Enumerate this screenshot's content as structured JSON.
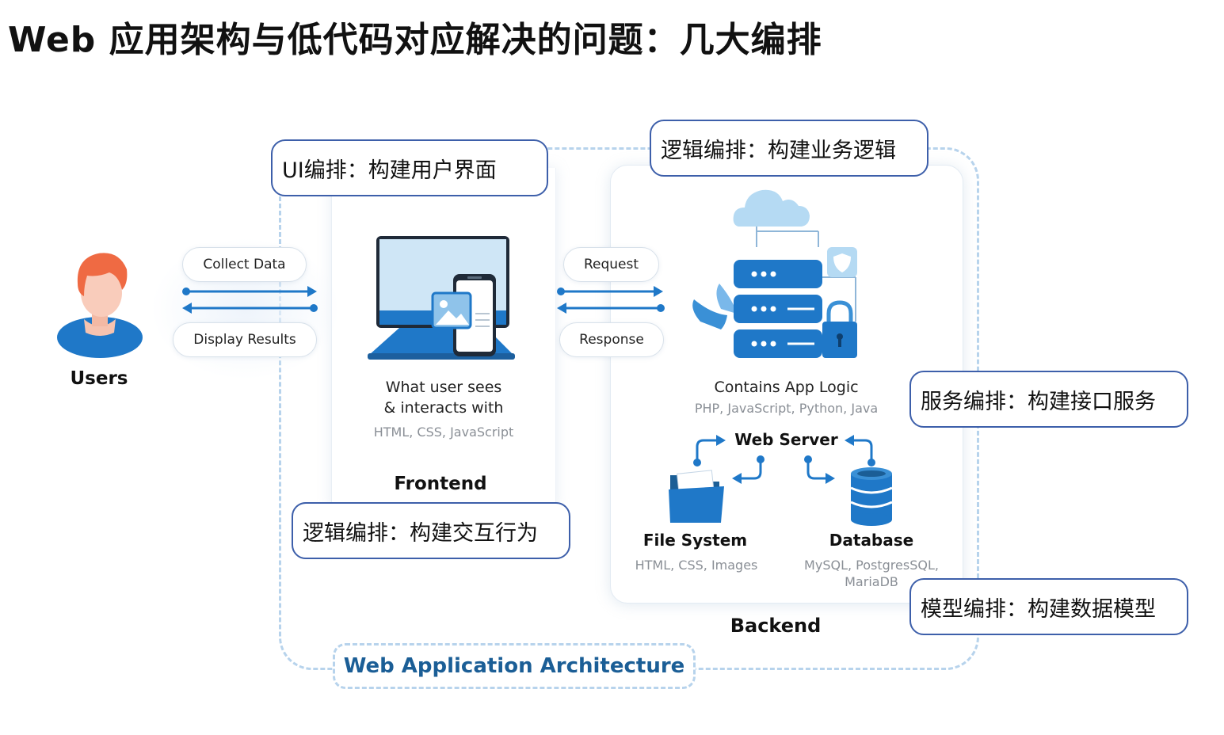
{
  "page_title": "Web 应用架构与低代码对应解决的问题：几大编排",
  "callouts": {
    "ui": "UI编排：构建用户界面",
    "logic_top": "逻辑编排：构建业务逻辑",
    "service": "服务编排：构建接口服务",
    "interaction": "逻辑编排：构建交互行为",
    "model": "模型编排：构建数据模型"
  },
  "users": {
    "label": "Users"
  },
  "user_flow": {
    "collect": "Collect Data",
    "display": "Display Results"
  },
  "http_flow": {
    "request": "Request",
    "response": "Response"
  },
  "frontend": {
    "desc_line1": "What user sees",
    "desc_line2": "& interacts  with",
    "tech": "HTML, CSS, JavaScript",
    "label": "Frontend"
  },
  "backend": {
    "desc": "Contains App Logic",
    "tech": "PHP, JavaScript, Python, Java",
    "web_server": "Web Server",
    "file_system": {
      "label": "File System",
      "tech": "HTML, CSS, Images"
    },
    "database": {
      "label": "Database",
      "tech_line1": "MySQL, PostgresSQL,",
      "tech_line2": "MariaDB"
    },
    "label": "Backend"
  },
  "architecture_title": "Web Application Architecture",
  "colors": {
    "accent_blue": "#1f78c8",
    "callout_border": "#3d5faa",
    "dash": "#b7d3ec",
    "title_blue": "#1b5e96",
    "hair": "#e8663a"
  }
}
